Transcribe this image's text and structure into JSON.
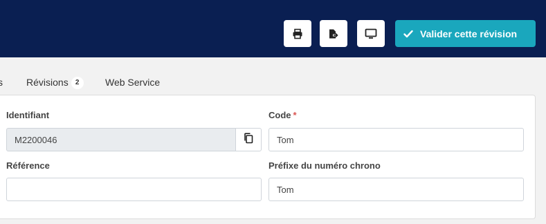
{
  "header": {
    "print_icon": "print-icon",
    "export_icon": "export-icon",
    "display_icon": "monitor-icon",
    "validate_label": "Valider cette révision",
    "brand_color": "#0a1f52",
    "accent_color": "#1aa7bd"
  },
  "tabs": [
    {
      "label": "s"
    },
    {
      "label": "Révisions",
      "badge": "2"
    },
    {
      "label": "Web Service"
    }
  ],
  "form": {
    "identifiant": {
      "label": "Identifiant",
      "value": "M2200046"
    },
    "code": {
      "label": "Code",
      "required_mark": "*",
      "value": "Tom"
    },
    "reference": {
      "label": "Référence",
      "value": ""
    },
    "prefixe": {
      "label": "Préfixe du numéro chrono",
      "value": "Tom"
    }
  }
}
